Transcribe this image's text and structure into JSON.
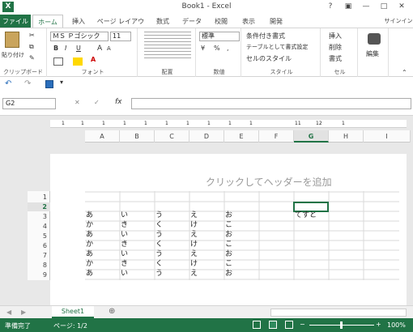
{
  "app": {
    "title": "Book1 - Excel",
    "icon": "X"
  },
  "window": {
    "help": "?",
    "restore": "▣",
    "minimize": "—",
    "maximize": "□",
    "close": "✕"
  },
  "tabs": [
    "ファイル",
    "ホーム",
    "挿入",
    "ページ レイアウト",
    "数式",
    "データ",
    "校閲",
    "表示",
    "開発"
  ],
  "signin": "サインイン",
  "ribbon": {
    "clipboard": {
      "paste": "貼り付け",
      "label": "クリップボード"
    },
    "font": {
      "name": "ＭＳ Ｐゴシック",
      "size": "11",
      "bold": "B",
      "italic": "I",
      "underline": "U",
      "grow": "A",
      "shrink": "A",
      "label": "フォント"
    },
    "alignment": {
      "label": "配置"
    },
    "number": {
      "format": "標準",
      "percent": "%",
      "comma": ",",
      "label": "数値"
    },
    "styles": {
      "conditional": "条件付き書式",
      "table": "テーブルとして書式設定",
      "cell": "セルのスタイル",
      "label": "スタイル"
    },
    "cells": {
      "insert": "挿入",
      "delete": "削除",
      "format": "書式",
      "label": "セル"
    },
    "editing": {
      "label": "編集"
    }
  },
  "namebox": "G2",
  "fx": "fx",
  "columns": [
    "A",
    "B",
    "C",
    "D",
    "E",
    "F",
    "G",
    "H",
    "I"
  ],
  "ruler": [
    "1",
    "1",
    "1",
    "1",
    "1",
    "1",
    "1",
    "1",
    "1",
    "1",
    "11",
    "12",
    "1"
  ],
  "header_prompt": "クリックしてヘッダーを追加",
  "rows": [
    "1",
    "2",
    "3",
    "4",
    "5",
    "6",
    "7",
    "8",
    "9"
  ],
  "cells": {
    "A3": "あ",
    "B3": "い",
    "C3": "う",
    "D3": "え",
    "E3": "お",
    "G3": "てすと",
    "A4": "か",
    "B4": "き",
    "C4": "く",
    "D4": "け",
    "E4": "こ",
    "A5": "あ",
    "B5": "い",
    "C5": "う",
    "D5": "え",
    "E5": "お",
    "A6": "か",
    "B6": "き",
    "C6": "く",
    "D6": "け",
    "E6": "こ",
    "A7": "あ",
    "B7": "い",
    "C7": "う",
    "D7": "え",
    "E7": "お",
    "A8": "か",
    "B8": "き",
    "C8": "く",
    "D8": "け",
    "E8": "こ",
    "A9": "あ",
    "B9": "い",
    "C9": "う",
    "D9": "え",
    "E9": "お"
  },
  "sheet_tab": "Sheet1",
  "status": {
    "ready": "準備完了",
    "page": "ページ: 1/2",
    "zoom": "100%",
    "minus": "−",
    "plus": "+"
  }
}
